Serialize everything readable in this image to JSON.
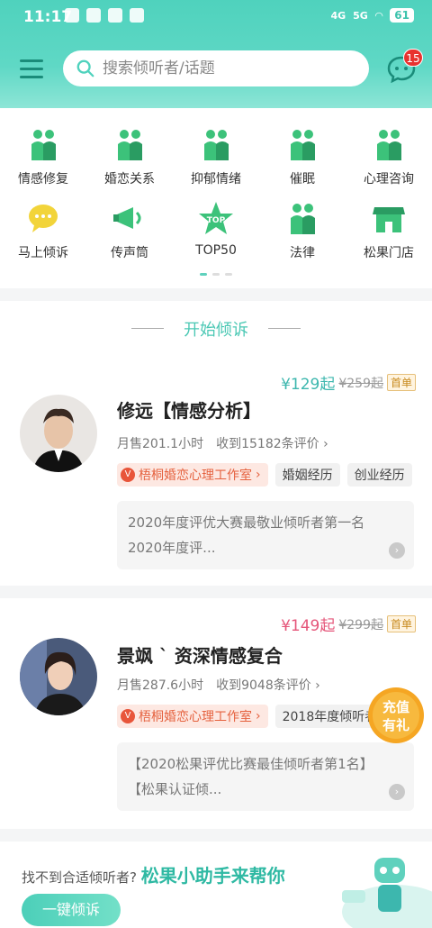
{
  "status_bar": {
    "time": "11:17",
    "network": "4G",
    "network2": "5G",
    "battery": "61"
  },
  "search": {
    "placeholder": "搜索倾听者/话题"
  },
  "messages": {
    "badge_count": "15"
  },
  "categories": [
    {
      "label": "情感修复",
      "icon": "couple-icon"
    },
    {
      "label": "婚恋关系",
      "icon": "couple-talk-icon"
    },
    {
      "label": "抑郁情绪",
      "icon": "desk-person-icon"
    },
    {
      "label": "催眠",
      "icon": "hypnosis-chair-icon"
    },
    {
      "label": "心理咨询",
      "icon": "counsel-icon"
    },
    {
      "label": "马上倾诉",
      "icon": "chat-bubble-icon"
    },
    {
      "label": "传声筒",
      "icon": "megaphone-icon"
    },
    {
      "label": "TOP50",
      "icon": "top-star-icon"
    },
    {
      "label": "法律",
      "icon": "lawyer-icon"
    },
    {
      "label": "松果门店",
      "icon": "store-icon"
    }
  ],
  "section_title": "开始倾诉",
  "listeners": [
    {
      "price": "¥129起",
      "old_price": "¥259起",
      "tag": "首单",
      "price_color": "#3db7ae",
      "name": "修远【情感分析】",
      "monthly": "月售201.1小时",
      "reviews": "收到15182条评价",
      "studio": "梧桐婚恋心理工作室",
      "tags": [
        "婚姻经历",
        "创业经历"
      ],
      "intro": [
        "2020年度评优大赛最敬业倾听者第一名",
        "2020年度评..."
      ]
    },
    {
      "price": "¥149起",
      "old_price": "¥299起",
      "tag": "首单",
      "price_color": "#e5567a",
      "name": "景飒 ` 资深情感复合",
      "monthly": "月售287.6小时",
      "reviews": "收到9048条评价",
      "studio": "梧桐婚恋心理工作室",
      "tags": [
        "2018年度倾听者"
      ],
      "intro": [
        "【2020松果评优比赛最佳倾听者第1名】",
        "【松果认证倾..."
      ]
    }
  ],
  "bottom": {
    "prefix": "找不到合适倾听者?",
    "highlight": "松果小助手来帮你",
    "button": "一键倾诉"
  },
  "promo": {
    "line1": "充值",
    "line2": "有礼"
  },
  "colors": {
    "accent": "#4fd2bd",
    "badge": "#e8322f"
  }
}
